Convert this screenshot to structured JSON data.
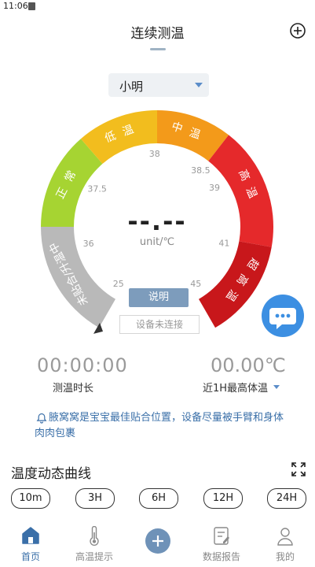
{
  "status_bar": {
    "time": "11:06"
  },
  "header": {
    "title": "连续测温"
  },
  "selector": {
    "value": "小明"
  },
  "gauge": {
    "zones": [
      {
        "label": "未贴合/升温中",
        "color": "#b9b9b9"
      },
      {
        "label": "正常",
        "color": "#a6d432"
      },
      {
        "label": "低温",
        "color": "#f2bd1e"
      },
      {
        "label": "中温",
        "color": "#f39a1a"
      },
      {
        "label": "高温",
        "color": "#e5292b"
      },
      {
        "label": "超高温",
        "color": "#c8171b"
      }
    ],
    "ticks": [
      "25",
      "36",
      "37.5",
      "38",
      "38.5",
      "39",
      "41",
      "45"
    ],
    "reading": "--.--",
    "unit": "unit/℃"
  },
  "explain_button": "说明",
  "connection_status": "设备未连接",
  "stats": {
    "duration_value": "00:00:00",
    "duration_label": "测温时长",
    "max_value": "00.00℃",
    "max_label": "近1H最高体温"
  },
  "tip": "腋窝窝是宝宝最佳贴合位置，设备尽量被手臂和身体肉肉包裹",
  "chart_section": {
    "title": "温度动态曲线",
    "ranges": [
      "10m",
      "3H",
      "6H",
      "12H",
      "24H"
    ]
  },
  "tabs": [
    {
      "label": "首页",
      "icon": "home-icon",
      "active": true
    },
    {
      "label": "高温提示",
      "icon": "thermometer-icon",
      "active": false
    },
    {
      "label": "",
      "icon": "add-icon",
      "active": false
    },
    {
      "label": "数据报告",
      "icon": "report-icon",
      "active": false
    },
    {
      "label": "我的",
      "icon": "user-icon",
      "active": false
    }
  ],
  "colors": {
    "accent": "#3a6fa8",
    "chat": "#3c8fe2",
    "button": "#7d9cbc"
  }
}
